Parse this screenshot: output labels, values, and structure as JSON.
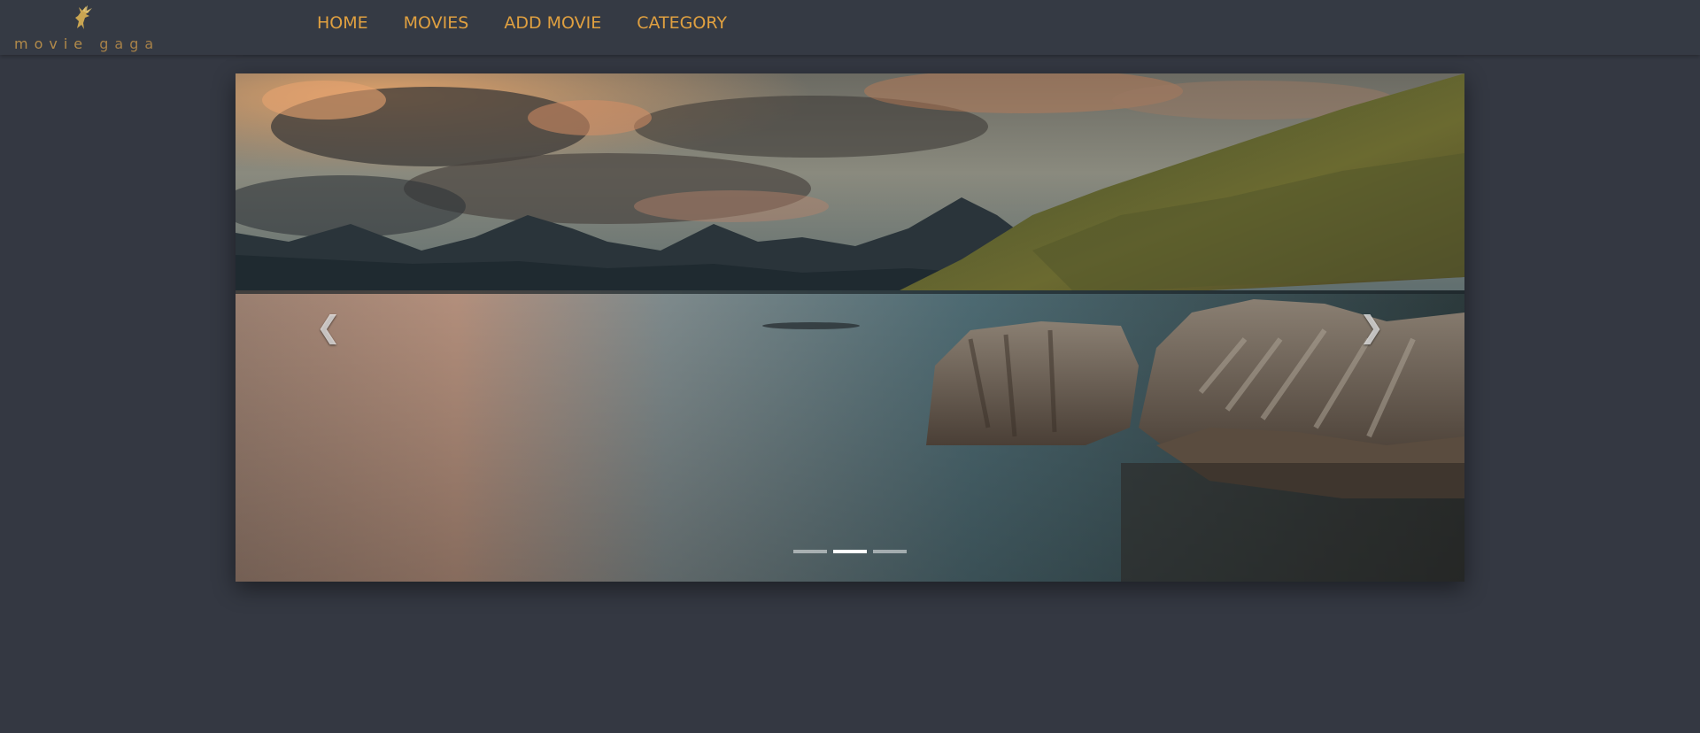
{
  "brand": {
    "text_part1": "movie",
    "text_part2": "gaga",
    "logo_icon": "pegasus-icon"
  },
  "nav": {
    "items": [
      {
        "label": "HOME"
      },
      {
        "label": "MOVIES"
      },
      {
        "label": "ADD MOVIE"
      },
      {
        "label": "CATEGORY"
      }
    ]
  },
  "carousel": {
    "prev_icon": "chevron-left-icon",
    "next_icon": "chevron-right-icon",
    "slide_count": 3,
    "active_index": 1
  },
  "colors": {
    "background": "#343842",
    "navbar": "#353a44",
    "nav_link": "#e0a040",
    "brand": "#b38b4a"
  }
}
